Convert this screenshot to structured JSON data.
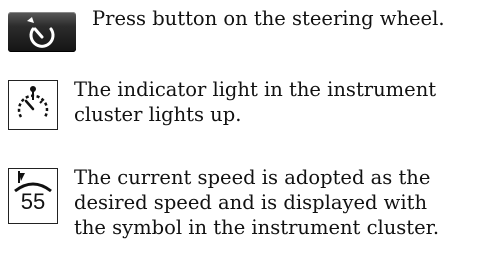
{
  "steps": [
    {
      "icon": "cruise-control-button-icon",
      "lines": [
        "Press button on the steering wheel."
      ]
    },
    {
      "icon": "cruise-control-indicator-icon",
      "lines": [
        "The indicator light in the instrument",
        "cluster lights up."
      ]
    },
    {
      "icon": "desired-speed-symbol-icon",
      "speed_value": "55",
      "lines": [
        "The current speed is adopted as the",
        "desired speed and is displayed with",
        "the symbol in the instrument cluster."
      ]
    }
  ]
}
